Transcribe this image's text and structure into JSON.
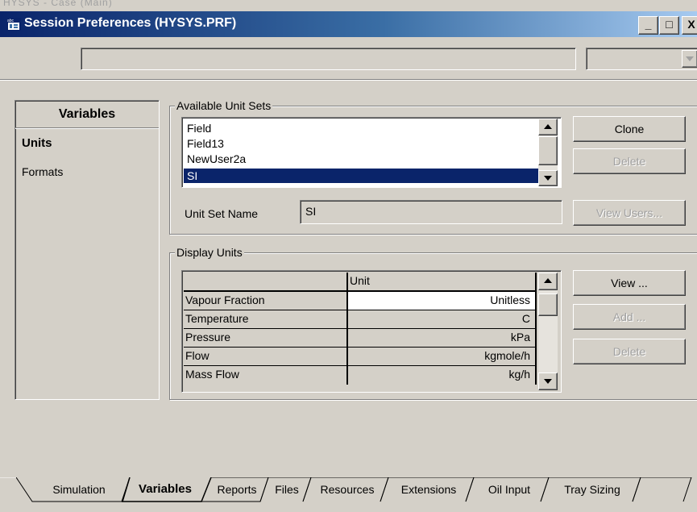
{
  "window": {
    "background_title": "HYSYS - Case (Main)",
    "title": "Session Preferences (HYSYS.PRF)",
    "controls": {
      "minimize": "_",
      "maximize": "□",
      "close": "X"
    }
  },
  "toolbar": {
    "text_field_value": "",
    "dropdown_value": ""
  },
  "sidebar": {
    "header": "Variables",
    "items": [
      {
        "label": "Units",
        "selected": true
      },
      {
        "label": "Formats",
        "selected": false
      }
    ]
  },
  "available_unit_sets": {
    "legend": "Available Unit Sets",
    "items": [
      "Field",
      "Field13",
      "NewUser2a",
      "SI"
    ],
    "selected": "SI",
    "buttons": {
      "clone": "Clone",
      "delete": "Delete",
      "view_users": "View Users..."
    },
    "unit_set_name_label": "Unit Set Name",
    "unit_set_name_value": "SI"
  },
  "display_units": {
    "legend": "Display Units",
    "column_header": "Unit",
    "rows": [
      {
        "variable": "Vapour Fraction",
        "unit": "Unitless"
      },
      {
        "variable": "Temperature",
        "unit": "C"
      },
      {
        "variable": "Pressure",
        "unit": "kPa"
      },
      {
        "variable": "Flow",
        "unit": "kgmole/h"
      },
      {
        "variable": "Mass Flow",
        "unit": "kg/h"
      }
    ],
    "buttons": {
      "view": "View ...",
      "add": "Add ...",
      "delete": "Delete"
    }
  },
  "tabs": [
    {
      "label": "Simulation",
      "active": false
    },
    {
      "label": "Variables",
      "active": true
    },
    {
      "label": "Reports",
      "active": false
    },
    {
      "label": "Files",
      "active": false
    },
    {
      "label": "Resources",
      "active": false
    },
    {
      "label": "Extensions",
      "active": false
    },
    {
      "label": "Oil Input",
      "active": false
    },
    {
      "label": "Tray Sizing",
      "active": false
    }
  ],
  "colors": {
    "selection": "#0a246a",
    "titlebar_start": "#0a246a",
    "titlebar_end": "#a6caf0",
    "face": "#d4d0c8"
  }
}
